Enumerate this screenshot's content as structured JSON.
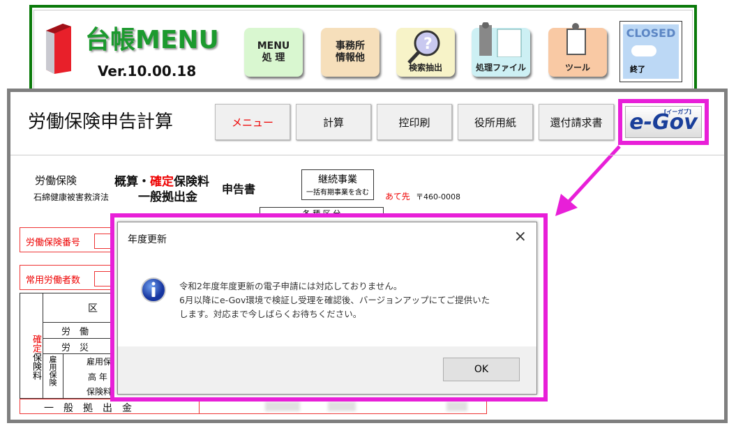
{
  "topmenu": {
    "title": "台帳MENU",
    "version": "Ver.10.00.18",
    "buttons": [
      {
        "label": "MENU\n処 理",
        "icon": "menu-icon",
        "color": "#d9f7d0"
      },
      {
        "label": "事務所\n情報他",
        "icon": "office-icon",
        "color": "#f6dfbb"
      },
      {
        "label": "検索抽出",
        "icon": "magnifier-icon",
        "color": "#f7f3c8"
      },
      {
        "label": "処理ファイル",
        "icon": "file-icon",
        "color": "#cdf0f4"
      },
      {
        "label": "ツール",
        "icon": "tool-icon",
        "color": "#f9c9a4"
      },
      {
        "label": "終了",
        "top": "CLOSED",
        "icon": "closed-icon",
        "color": "#bcd8f5"
      }
    ]
  },
  "screen": {
    "title": "労働保険申告計算",
    "buttons": [
      "メニュー",
      "計算",
      "控印刷",
      "役所用紙",
      "還付請求書"
    ],
    "egov": "e-Gov",
    "egov_sub": "[イーガブ]"
  },
  "form": {
    "l1": "労働保険",
    "l2": "石綿健康被害救済法",
    "t1a": "概算・",
    "t1b": "確定",
    "t1c": "保険料",
    "t2": "一般拠出金",
    "t3": "申告書",
    "box1": "継続事業",
    "box2": "一括有期事業を含む",
    "addr_label": "あて先",
    "addr": "〒460-0008",
    "kind": "各 種 区 分",
    "f1": "労働保険番号",
    "f2": "常用労働者数",
    "side1": "確定",
    "side2": "保険料",
    "h": "区",
    "r1": "労　働",
    "r2": "労　災",
    "koyo": "雇用保険",
    "r3": "雇用保",
    "r4": "高 年",
    "r5": "保険料",
    "ippan": "一　般　拠　出　金"
  },
  "dialog": {
    "title": "年度更新",
    "icon": "info-icon",
    "lines": [
      "令和2年度年度更新の電子申請には対応しておりません。",
      "6月以降にe-Gov環境で検証し受理を確認後、バージョンアップにてご提供いた",
      "します。対応まで今しばらくお待ちください。"
    ],
    "ok": "OK",
    "close": "×"
  },
  "colors": {
    "highlight": "#e81fd8",
    "frame_green": "#0a7a0a",
    "frame_gray": "#7f7f7f"
  }
}
